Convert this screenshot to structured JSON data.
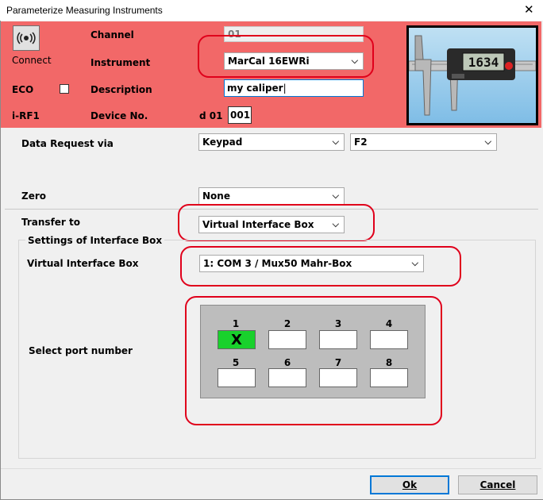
{
  "window": {
    "title": "Parameterize Measuring Instruments",
    "close_glyph": "✕"
  },
  "header": {
    "connect_label": "Connect",
    "eco_label": "ECO",
    "eco_checked": false,
    "irf_label": "i-RF1",
    "channel_label": "Channel",
    "channel_value": "01",
    "instrument_label": "Instrument",
    "instrument_value": "MarCal 16EWRi",
    "description_label": "Description",
    "description_value": "my caliper",
    "device_label": "Device No.",
    "device_prefix": "d 01",
    "device_value": "001",
    "caliper_display": "1634"
  },
  "data_request": {
    "label": "Data Request via",
    "mode_value": "Keypad",
    "key_value": "F2"
  },
  "zero": {
    "label": "Zero",
    "value": "None"
  },
  "transfer": {
    "label": "Transfer to",
    "value": "Virtual Interface Box"
  },
  "interface_settings": {
    "group_title": "Settings of Interface Box",
    "vib_label": "Virtual Interface Box",
    "vib_value": "1: COM 3 / Mux50 Mahr-Box",
    "port_label": "Select port number",
    "ports": [
      {
        "number": "1",
        "mark": "X",
        "selected": true
      },
      {
        "number": "2",
        "mark": "",
        "selected": false
      },
      {
        "number": "3",
        "mark": "",
        "selected": false
      },
      {
        "number": "4",
        "mark": "",
        "selected": false
      },
      {
        "number": "5",
        "mark": "",
        "selected": false
      },
      {
        "number": "6",
        "mark": "",
        "selected": false
      },
      {
        "number": "7",
        "mark": "",
        "selected": false
      },
      {
        "number": "8",
        "mark": "",
        "selected": false
      }
    ]
  },
  "footer": {
    "ok_label": "Ok",
    "cancel_label": "Cancel"
  },
  "colors": {
    "header_bg": "#f26868",
    "highlight": "#e0001b",
    "port_selected": "#19d12c",
    "focus": "#0078d7"
  }
}
